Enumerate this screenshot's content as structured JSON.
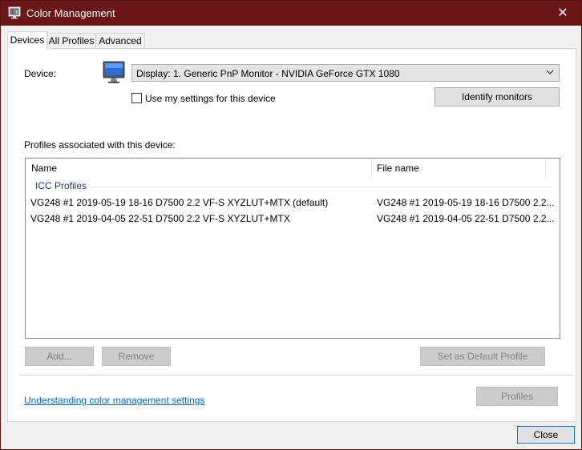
{
  "window": {
    "title": "Color Management",
    "close_glyph": "✕"
  },
  "tabs": [
    {
      "label": "Devices",
      "active": true
    },
    {
      "label": "All Profiles",
      "active": false
    },
    {
      "label": "Advanced",
      "active": false
    }
  ],
  "device": {
    "label": "Device:",
    "selected": "Display: 1. Generic PnP Monitor - NVIDIA GeForce GTX 1080",
    "use_settings_label": "Use my settings for this device",
    "use_settings_checked": false,
    "identify_button": "Identify monitors"
  },
  "profiles": {
    "section_label": "Profiles associated with this device:",
    "columns": [
      "Name",
      "File name"
    ],
    "group": "ICC Profiles",
    "rows": [
      {
        "name": "VG248 #1 2019-05-19 18-16 D7500 2.2 VF-S XYZLUT+MTX (default)",
        "file": "VG248 #1 2019-05-19 18-16 D7500 2.2..."
      },
      {
        "name": "VG248 #1 2019-04-05 22-51 D7500 2.2 VF-S XYZLUT+MTX",
        "file": "VG248 #1 2019-04-05 22-51 D7500 2.2..."
      }
    ],
    "add_button": "Add...",
    "remove_button": "Remove",
    "default_button": "Set as Default Profile"
  },
  "footer": {
    "link": "Understanding color management settings",
    "profiles_button": "Profiles",
    "close_button": "Close"
  },
  "icons": {
    "app": "color-management-icon",
    "monitor": "monitor-icon",
    "dropdown": "chevron-down-icon"
  },
  "colors": {
    "titlebar": "#6b1616",
    "link": "#0066cc",
    "group_header": "#1e3287"
  }
}
